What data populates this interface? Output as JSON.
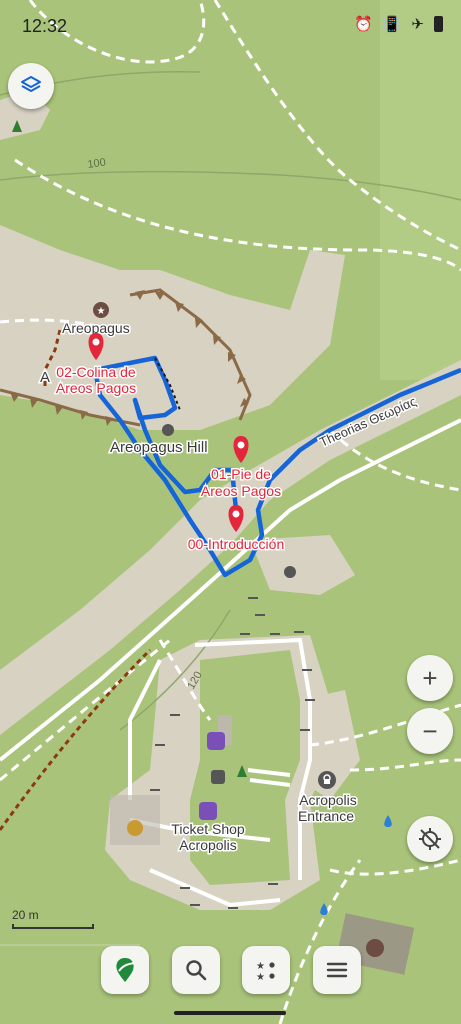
{
  "status_bar": {
    "time": "12:32",
    "icons": [
      "alarm-icon",
      "vibrate-icon",
      "airplane-mode-icon",
      "battery-icon"
    ]
  },
  "map": {
    "places": [
      {
        "name": "Areopagus",
        "icon": "star-icon"
      },
      {
        "name": "Areopagus Hill"
      },
      {
        "name": "Acropolis Entrance",
        "icon": "lock-icon"
      },
      {
        "name": "Ticket Shop Acropolis",
        "icon": "shop-icon"
      }
    ],
    "street_name": "Theorias  Θεωρίας",
    "contour_labels": [
      "100",
      "120"
    ],
    "route_waypoints": [
      {
        "label_lines": [
          "02-Colina de",
          "Areos Pagos"
        ]
      },
      {
        "label_lines": [
          "01-Pie de",
          "Areos Pagos"
        ]
      },
      {
        "label_lines": [
          "00-Introducción"
        ]
      }
    ],
    "partial_label": "A",
    "scale_label": "20 m",
    "colors": {
      "route": "#1565d8",
      "pin": "#e3263b",
      "park": "#a9c47a",
      "rock": "#d8d2c3",
      "paths": "#ffffff"
    }
  },
  "controls": {
    "layers_button": "layers-icon",
    "zoom_in": "+",
    "zoom_out": "−",
    "location_button": "location-disabled-icon"
  },
  "bottom_toolbar": [
    {
      "name": "app-logo-button",
      "icon": "trail-logo-icon"
    },
    {
      "name": "search-button",
      "icon": "search-icon"
    },
    {
      "name": "favorites-button",
      "icon": "stars-icon"
    },
    {
      "name": "menu-button",
      "icon": "menu-icon"
    }
  ]
}
